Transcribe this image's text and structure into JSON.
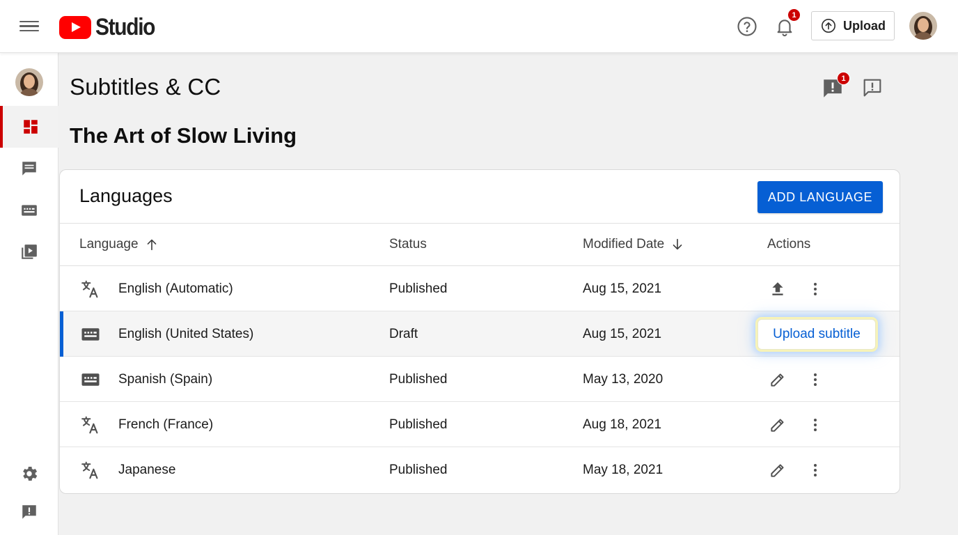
{
  "header": {
    "logo_text": "Studio",
    "notifications_count": "1",
    "upload_label": "Upload"
  },
  "page": {
    "title": "Subtitles & CC",
    "video_title": "The Art of Slow Living",
    "feedback_badge": "1"
  },
  "languages": {
    "title": "Languages",
    "add_button": "ADD LANGUAGE",
    "columns": {
      "language": "Language",
      "status": "Status",
      "modified": "Modified Date",
      "actions": "Actions"
    },
    "rows": [
      {
        "icon": "translate-icon",
        "language": "English (Automatic)",
        "status": "Published",
        "date": "Aug 15, 2021",
        "action": "upload-icon"
      },
      {
        "icon": "subtitles-icon",
        "language": "English (United States)",
        "status": "Draft",
        "date": "Aug 15, 2021",
        "action": "Upload subtitle"
      },
      {
        "icon": "subtitles-icon",
        "language": "Spanish (Spain)",
        "status": "Published",
        "date": "May 13, 2020",
        "action": "edit-icon"
      },
      {
        "icon": "translate-icon",
        "language": "French (France)",
        "status": "Published",
        "date": "Aug 18, 2021",
        "action": "edit-icon"
      },
      {
        "icon": "translate-icon",
        "language": "Japanese",
        "status": "Published",
        "date": "May 18, 2021",
        "action": "edit-icon"
      }
    ]
  },
  "colors": {
    "brand_red": "#ff0000",
    "accent_blue": "#065fd4",
    "badge_red": "#cc0000"
  }
}
